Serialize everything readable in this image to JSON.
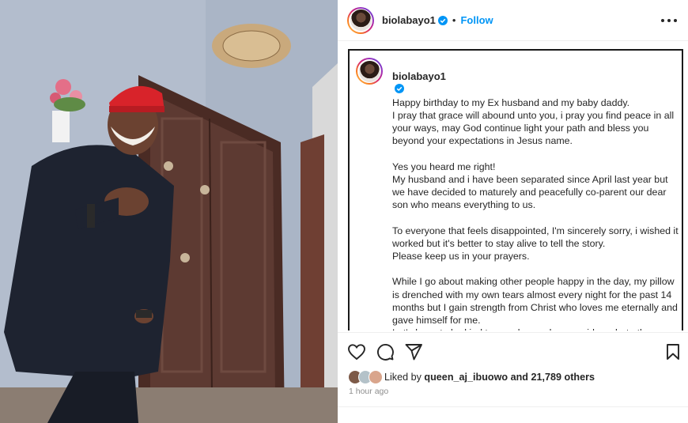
{
  "post": {
    "username": "biolabayo1",
    "separator": "•",
    "follow_label": "Follow"
  },
  "caption": {
    "username": "biolabayo1",
    "paragraphs": [
      "Happy birthday to my Ex husband and my baby daddy.\nI pray that grace will abound unto you, i pray you find peace in all your ways, may God continue light your path and bless you beyond your expectations in Jesus name.",
      "Yes you heard me right!\nMy husband and i have been separated since April last year but we have decided to maturely and peacefully co-parent our dear son who means everything to us.",
      "To everyone that feels disappointed, I'm sincerely sorry, i wished it worked but it's better to stay alive to tell the story.\nPlease keep us in your prayers.",
      "While I go about making other people happy in the day, my pillow is drenched with my own tears almost every night for the past 14 months but I gain strength from Christ who loves me eternally and gave himself for me.\nLet's learn to be kind to people, you have no idea what others are going through until they say it."
    ]
  },
  "engagement": {
    "liked_by_prefix": "Liked by",
    "liked_by_user": "queen_aj_ibuowo",
    "liked_by_suffix": "and 21,789 others",
    "timestamp": "1 hour ago"
  },
  "icons": {
    "more": "more-horizontal-icon",
    "verified": "verified-badge-icon",
    "like": "heart-icon",
    "comment": "comment-icon",
    "share": "share-icon",
    "save": "bookmark-icon"
  },
  "colors": {
    "accent": "#0095f6",
    "text": "#262626",
    "muted": "#8e8e8e"
  }
}
